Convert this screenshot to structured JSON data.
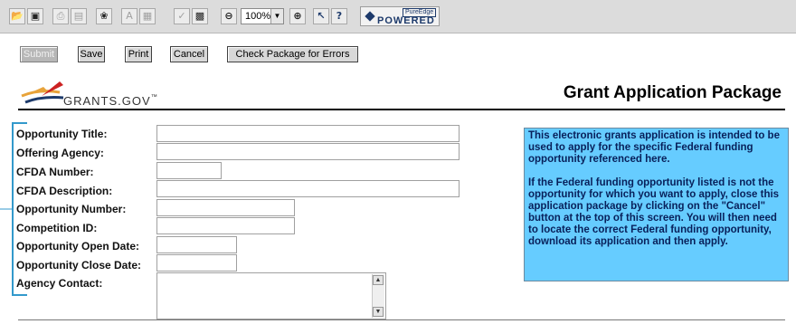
{
  "toolbar": {
    "zoom_value": "100%",
    "help_label": "?",
    "powered_label": "POWERED",
    "powered_brand": "PureEdge",
    "icons": [
      "open-folder-icon",
      "save-disk-icon",
      "print-icon",
      "pages-icon",
      "globe-icon",
      "text-icon",
      "grid-icon",
      "check-icon",
      "save-form-icon",
      "zoom-out-icon",
      "zoom-in-icon",
      "cursor-help-icon",
      "help-icon",
      "pureedge-logo-icon"
    ]
  },
  "actions": {
    "submit": "Submit",
    "save": "Save",
    "print": "Print",
    "cancel": "Cancel",
    "check": "Check Package for Errors"
  },
  "header": {
    "logo_text": "GRANTS.GOV",
    "logo_mark": "™",
    "title": "Grant Application Package"
  },
  "form": {
    "fields": [
      {
        "label": "Opportunity Title:",
        "value": ""
      },
      {
        "label": "Offering Agency:",
        "value": ""
      },
      {
        "label": "CFDA Number:",
        "value": ""
      },
      {
        "label": "CFDA Description:",
        "value": ""
      },
      {
        "label": "Opportunity Number:",
        "value": ""
      },
      {
        "label": "Competition ID:",
        "value": ""
      },
      {
        "label": "Opportunity Open Date:",
        "value": ""
      },
      {
        "label": "Opportunity Close Date:",
        "value": ""
      },
      {
        "label": "Agency Contact:",
        "value": ""
      }
    ]
  },
  "info": {
    "paragraph1": "This electronic grants application is intended to be used to apply for the specific Federal funding opportunity referenced here.",
    "paragraph2": "If the Federal funding opportunity listed is not the opportunity for which you want to apply, close this application package by clicking on the \"Cancel\" button at the top of this screen. You will then need to locate the correct Federal funding opportunity, download its application and then apply."
  },
  "colors": {
    "toolbar_bg": "#dcdcdc",
    "info_bg": "#66ccff",
    "info_text": "#08205a",
    "bracket": "#3399cc",
    "logo_red": "#cc2222",
    "logo_orange": "#e8a33a",
    "logo_navy": "#1d3a6b"
  }
}
